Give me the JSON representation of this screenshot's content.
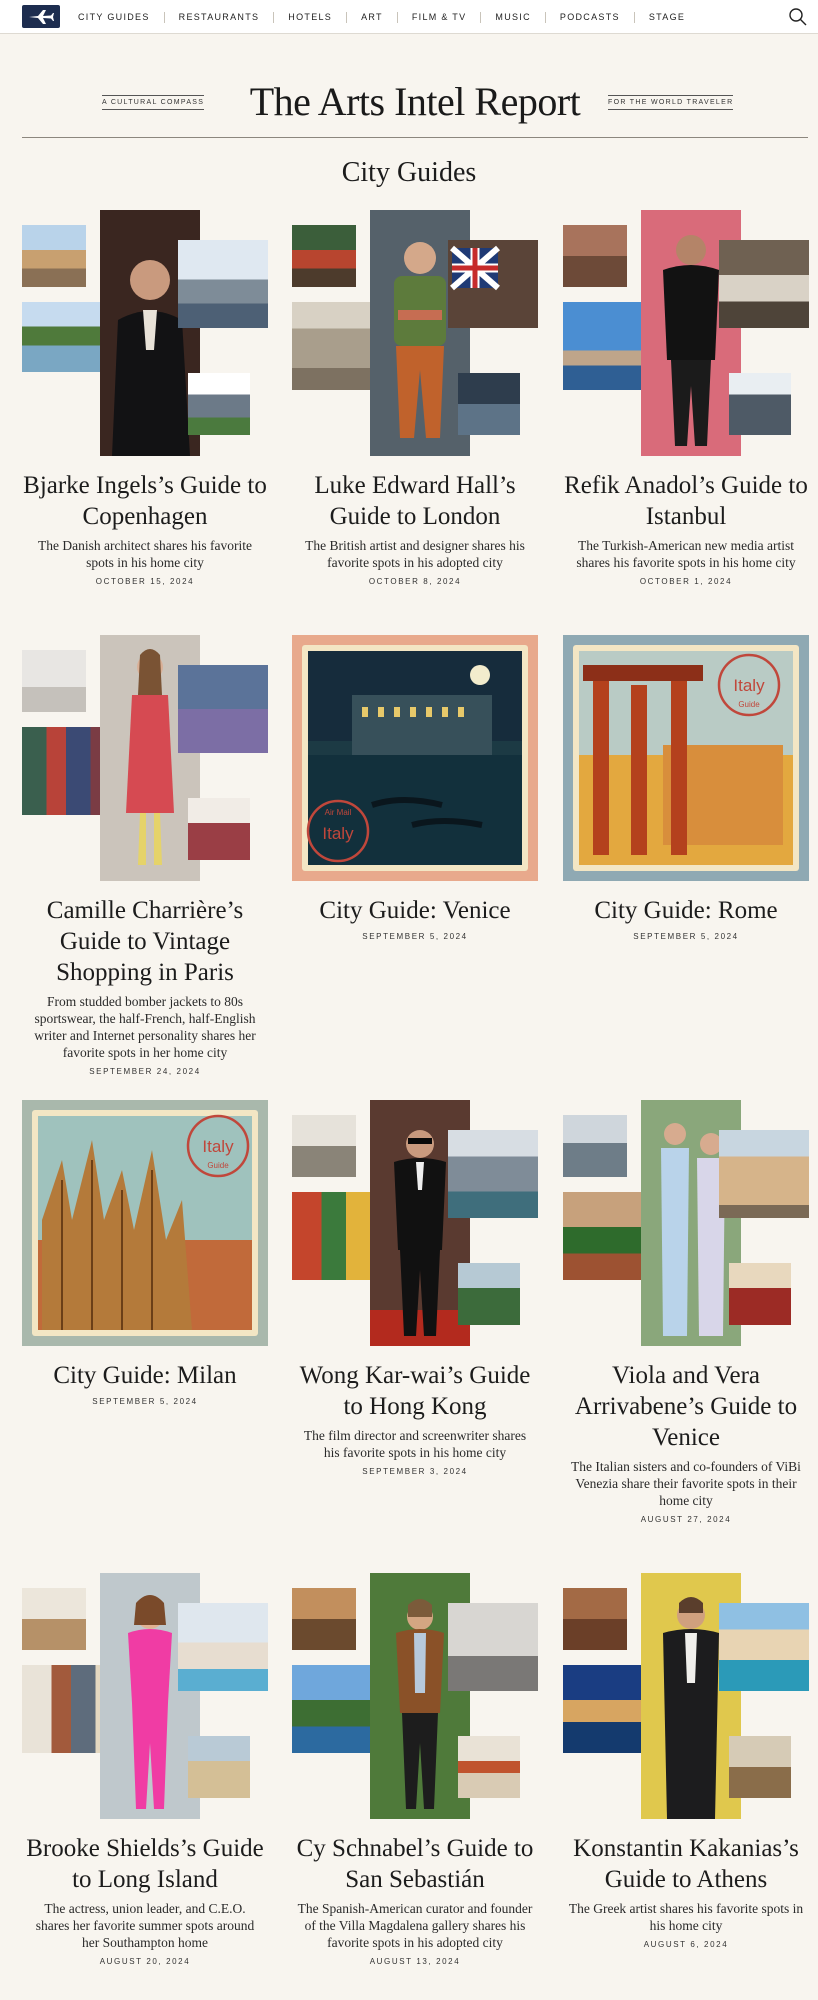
{
  "nav": {
    "items": [
      "City Guides",
      "Restaurants",
      "Hotels",
      "Art",
      "Film & TV",
      "Music",
      "Podcasts",
      "Stage"
    ]
  },
  "masthead": {
    "tag_left": "A Cultural Compass",
    "title": "The Arts Intel Report",
    "tag_right": "For the World Traveler"
  },
  "section": {
    "title": "City Guides"
  },
  "cards": [
    {
      "title": "Bjarke Ingels’s Guide to Copenhagen",
      "desc": "The Danish architect shares his favorite spots in his home city",
      "date": "October 15, 2024"
    },
    {
      "title": "Luke Edward Hall’s Guide to London",
      "desc": "The British artist and designer shares his favorite spots in his adopted city",
      "date": "October 8, 2024"
    },
    {
      "title": "Refik Anadol’s Guide to Istanbul",
      "desc": "The Turkish-American new media artist shares his favorite spots in his home city",
      "date": "October 1, 2024"
    },
    {
      "title": "Camille Charrière’s Guide to Vintage Shopping in Paris",
      "desc": "From studded bomber jackets to 80s sportswear, the half-French, half-English writer and Internet personality shares her favorite spots in her home city",
      "date": "September 24, 2024"
    },
    {
      "title": "City Guide: Venice",
      "desc": "",
      "date": "September 5, 2024",
      "stamp": "Italy",
      "stamp_top": "Air Mail"
    },
    {
      "title": "City Guide: Rome",
      "desc": "",
      "date": "September 5, 2024",
      "stamp": "Italy",
      "stamp_bottom": "Guide"
    },
    {
      "title": "City Guide: Milan",
      "desc": "",
      "date": "September 5, 2024",
      "stamp": "Italy",
      "stamp_bottom": "Guide"
    },
    {
      "title": "Wong Kar-wai’s Guide to Hong Kong",
      "desc": "The film director and screenwriter shares his favorite spots in his home city",
      "date": "September 3, 2024"
    },
    {
      "title": "Viola and Vera Arrivabene’s Guide to Venice",
      "desc": "The Italian sisters and co-founders of ViBi Venezia share their favorite spots in their home city",
      "date": "August 27, 2024"
    },
    {
      "title": "Brooke Shields’s Guide to Long Island",
      "desc": "The actress, union leader, and C.E.O. shares her favorite summer spots around her Southampton home",
      "date": "August 20, 2024"
    },
    {
      "title": "Cy Schnabel’s Guide to San Sebastián",
      "desc": "The Spanish-American curator and founder of the Villa Magdalena gallery shares his favorite spots in his adopted city",
      "date": "August 13, 2024"
    },
    {
      "title": "Konstantin Kakanias’s Guide to Athens",
      "desc": "The Greek artist shares his favorite spots in his home city",
      "date": "August 6, 2024"
    }
  ],
  "icons": {
    "logo": "airplane-logo-icon",
    "search": "search-icon"
  },
  "colors": {
    "nav_bg": "#ffffff",
    "page_bg": "#f8f5ef",
    "logo_bg": "#1d2d4f",
    "stamp_red": "#c0473b"
  }
}
